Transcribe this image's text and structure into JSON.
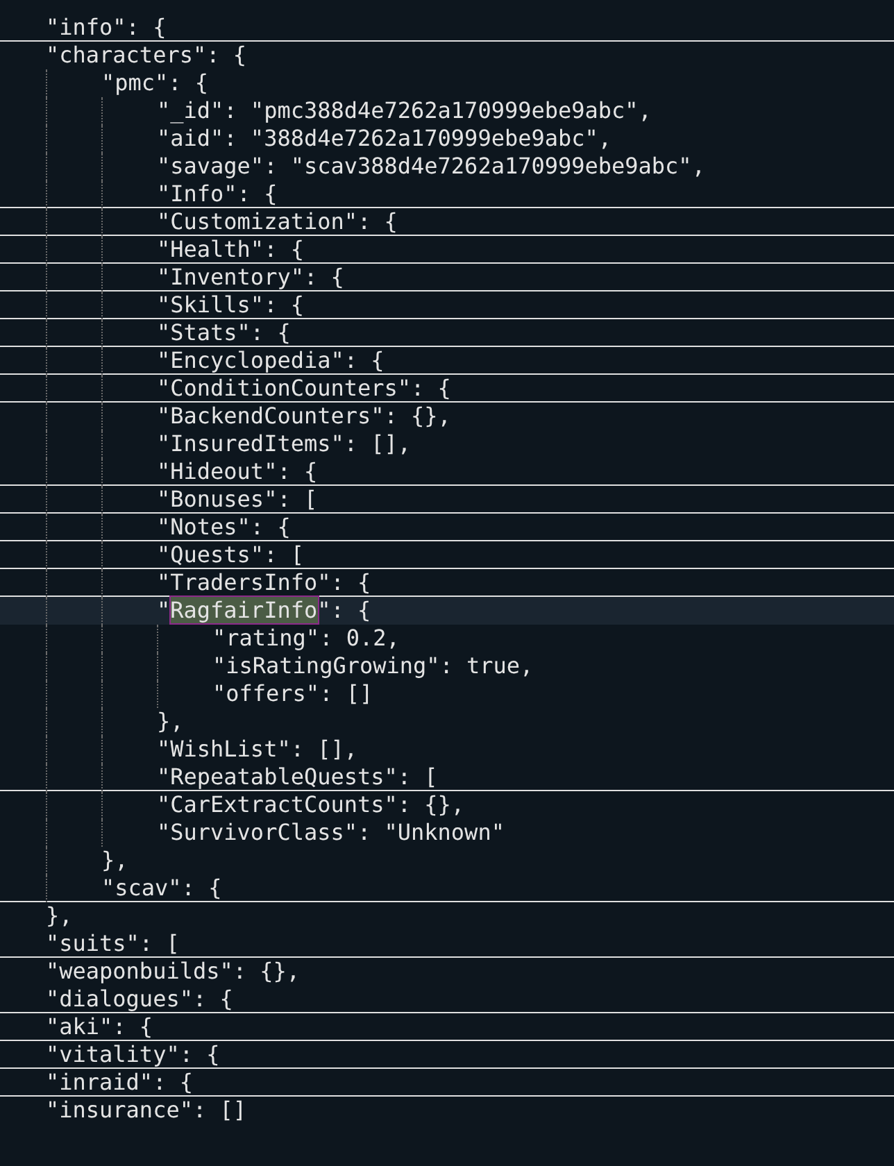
{
  "editor": {
    "lines": [
      {
        "text": "\"info\": {",
        "folded": true,
        "selected": false
      },
      {
        "text": "\"characters\": {",
        "folded": false,
        "selected": false,
        "children": [
          {
            "text": "\"pmc\": {",
            "folded": false,
            "selected": false,
            "children": [
              {
                "text": "\"_id\": \"pmc388d4e7262a170999ebe9abc\",",
                "folded": false,
                "selected": false
              },
              {
                "text": "\"aid\": \"388d4e7262a170999ebe9abc\",",
                "folded": false,
                "selected": false
              },
              {
                "text": "\"savage\": \"scav388d4e7262a170999ebe9abc\",",
                "folded": false,
                "selected": false
              },
              {
                "text": "\"Info\": {",
                "folded": true,
                "selected": false
              },
              {
                "text": "\"Customization\": {",
                "folded": true,
                "selected": false
              },
              {
                "text": "\"Health\": {",
                "folded": true,
                "selected": false
              },
              {
                "text": "\"Inventory\": {",
                "folded": true,
                "selected": false
              },
              {
                "text": "\"Skills\": {",
                "folded": true,
                "selected": false
              },
              {
                "text": "\"Stats\": {",
                "folded": true,
                "selected": false
              },
              {
                "text": "\"Encyclopedia\": {",
                "folded": true,
                "selected": false
              },
              {
                "text": "\"ConditionCounters\": {",
                "folded": true,
                "selected": false
              },
              {
                "text": "\"BackendCounters\": {},",
                "folded": false,
                "selected": false
              },
              {
                "text": "\"InsuredItems\": [],",
                "folded": false,
                "selected": false
              },
              {
                "text": "\"Hideout\": {",
                "folded": true,
                "selected": false
              },
              {
                "text": "\"Bonuses\": [",
                "folded": true,
                "selected": false
              },
              {
                "text": "\"Notes\": {",
                "folded": true,
                "selected": false
              },
              {
                "text": "\"Quests\": [",
                "folded": true,
                "selected": false
              },
              {
                "text": "\"TradersInfo\": {",
                "folded": true,
                "selected": false
              },
              {
                "prefix": "\"",
                "match": "RagfairInfo",
                "suffix": "\": {",
                "folded": false,
                "selected": true,
                "children": [
                  {
                    "text": "\"rating\": 0.2,",
                    "folded": false,
                    "selected": false
                  },
                  {
                    "text": "\"isRatingGrowing\": true,",
                    "folded": false,
                    "selected": false
                  },
                  {
                    "text": "\"offers\": []",
                    "folded": false,
                    "selected": false
                  }
                ]
              },
              {
                "text": "},",
                "folded": false,
                "selected": false
              },
              {
                "text": "\"WishList\": [],",
                "folded": false,
                "selected": false
              },
              {
                "text": "\"RepeatableQuests\": [",
                "folded": true,
                "selected": false
              },
              {
                "text": "\"CarExtractCounts\": {},",
                "folded": false,
                "selected": false
              },
              {
                "text": "\"SurvivorClass\": \"Unknown\"",
                "folded": false,
                "selected": false
              }
            ]
          },
          {
            "text": "},",
            "folded": false,
            "selected": false
          },
          {
            "text": "\"scav\": {",
            "folded": true,
            "selected": false
          }
        ]
      },
      {
        "text": "},",
        "folded": false,
        "selected": false
      },
      {
        "text": "\"suits\": [",
        "folded": true,
        "selected": false
      },
      {
        "text": "\"weaponbuilds\": {},",
        "folded": false,
        "selected": false
      },
      {
        "text": "\"dialogues\": {",
        "folded": true,
        "selected": false
      },
      {
        "text": "\"aki\": {",
        "folded": true,
        "selected": false
      },
      {
        "text": "\"vitality\": {",
        "folded": true,
        "selected": false
      },
      {
        "text": "\"inraid\": {",
        "folded": true,
        "selected": false
      },
      {
        "text": "\"insurance\": []",
        "folded": false,
        "selected": false
      }
    ]
  }
}
